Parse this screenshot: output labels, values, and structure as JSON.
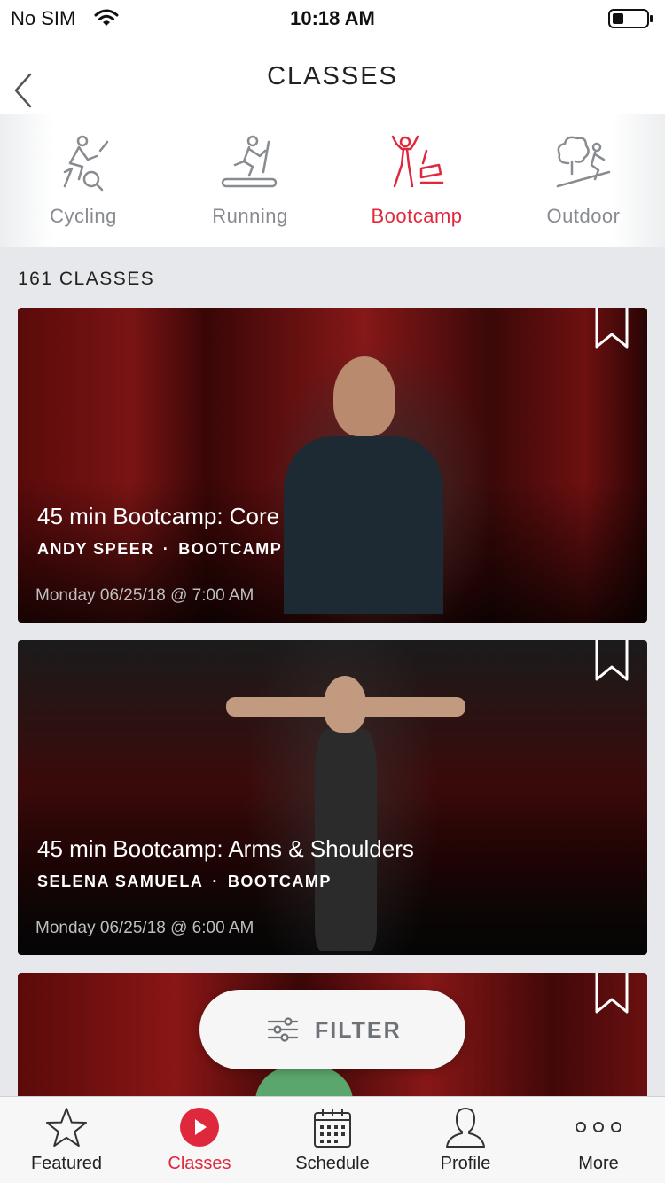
{
  "status_bar": {
    "carrier": "No SIM",
    "time": "10:18 AM"
  },
  "header": {
    "title": "CLASSES"
  },
  "categories": [
    {
      "label": "Cycling",
      "icon": "cycling-icon",
      "active": false
    },
    {
      "label": "Running",
      "icon": "running-icon",
      "active": false
    },
    {
      "label": "Bootcamp",
      "icon": "bootcamp-icon",
      "active": true
    },
    {
      "label": "Outdoor",
      "icon": "outdoor-icon",
      "active": false
    }
  ],
  "class_count": "161 CLASSES",
  "classes": [
    {
      "title": "45 min Bootcamp: Core",
      "instructor": "ANDY SPEER",
      "separator": "·",
      "type": "BOOTCAMP",
      "date": "Monday 06/25/18 @ 7:00 AM"
    },
    {
      "title": "45 min Bootcamp: Arms & Shoulders",
      "instructor": "SELENA SAMUELA",
      "separator": "·",
      "type": "BOOTCAMP",
      "date": "Monday 06/25/18 @ 6:00 AM"
    }
  ],
  "filter": {
    "label": "FILTER",
    "icon": "sliders-icon"
  },
  "tab_bar": [
    {
      "label": "Featured",
      "icon": "star-icon",
      "active": false
    },
    {
      "label": "Classes",
      "icon": "play-circle-icon",
      "active": true
    },
    {
      "label": "Schedule",
      "icon": "calendar-icon",
      "active": false
    },
    {
      "label": "Profile",
      "icon": "person-icon",
      "active": false
    },
    {
      "label": "More",
      "icon": "more-dots-icon",
      "active": false
    }
  ],
  "colors": {
    "accent": "#e0283d",
    "inactive": "#888b90"
  }
}
